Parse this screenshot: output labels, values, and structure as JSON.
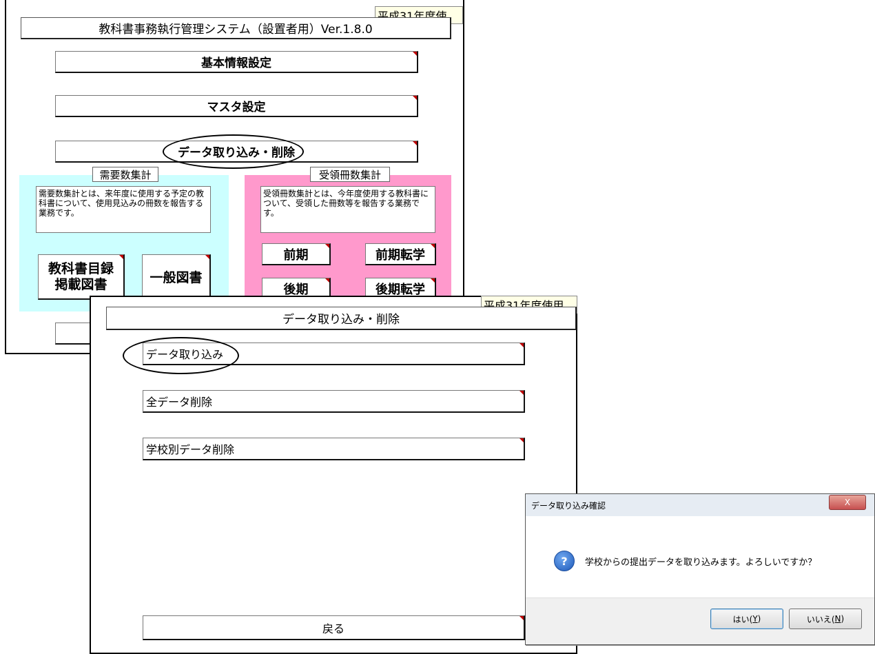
{
  "main_window": {
    "year_label": "平成31年度使",
    "title": "教科書事務執行管理システム（設置者用）Ver.1.8.0",
    "buttons": {
      "basic_info": "基本情報設定",
      "master": "マスタ設定",
      "data_import_delete": "データ取り込み・削除"
    },
    "demand": {
      "label": "需要数集計",
      "description": "需要数集計とは、来年度に使用する予定の教科書について、使用見込みの冊数を報告する業務です。",
      "btn_catalog_line1": "教科書目録",
      "btn_catalog_line2": "掲載図書",
      "btn_general": "一般図書"
    },
    "received": {
      "label": "受領冊数集計",
      "description": "受領冊数集計とは、今年度使用する教科書について、受領した冊数等を報告する業務です。",
      "btn_first": "前期",
      "btn_first_transfer": "前期転学",
      "btn_second": "後期",
      "btn_second_transfer": "後期転学"
    }
  },
  "sub_window": {
    "year_label": "平成31年度使用",
    "title": "データ取り込み・削除",
    "buttons": {
      "import": "データ取り込み",
      "delete_all": "全データ削除",
      "delete_by_school": "学校別データ削除",
      "back": "戻る"
    }
  },
  "dialog": {
    "title": "データ取り込み確認",
    "close": "X",
    "icon": "question-icon",
    "message": "学校からの提出データを取り込みます。よろしいですか？",
    "yes_prefix": "はい(",
    "yes_key": "Y",
    "yes_suffix": ")",
    "no_prefix": "いいえ(",
    "no_key": "N",
    "no_suffix": ")"
  }
}
